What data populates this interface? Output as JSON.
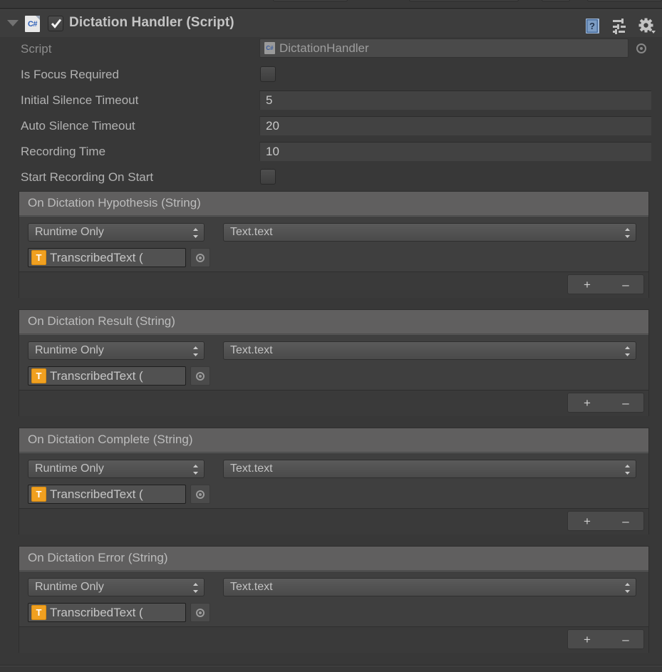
{
  "component": {
    "title": "Dictation Handler (Script)",
    "enabled": true,
    "script_icon": "csharp-script-icon",
    "foldout_expanded": true,
    "header_icons": [
      {
        "name": "help-icon",
        "glyph": "?"
      },
      {
        "name": "preset-icon",
        "glyph": "preset"
      },
      {
        "name": "settings-gear-icon",
        "glyph": "gear"
      }
    ]
  },
  "properties": [
    {
      "label": "Script",
      "type": "object",
      "value": "DictationHandler",
      "dim": true,
      "icon": "csharp-script-icon"
    },
    {
      "label": "Is Focus Required",
      "type": "checkbox",
      "value": false
    },
    {
      "label": "Initial Silence Timeout",
      "type": "number",
      "value": "5"
    },
    {
      "label": "Auto Silence Timeout",
      "type": "number",
      "value": "20"
    },
    {
      "label": "Recording Time",
      "type": "number",
      "value": "10"
    },
    {
      "label": "Start Recording On Start",
      "type": "checkbox",
      "value": false
    }
  ],
  "events": [
    {
      "title": "On Dictation Hypothesis (String)",
      "listener": {
        "mode": "Runtime Only",
        "target": "TranscribedText (",
        "target_icon": "T",
        "method": "Text.text"
      },
      "add_label": "+",
      "remove_label": "–"
    },
    {
      "title": "On Dictation Result (String)",
      "listener": {
        "mode": "Runtime Only",
        "target": "TranscribedText (",
        "target_icon": "T",
        "method": "Text.text"
      },
      "add_label": "+",
      "remove_label": "–"
    },
    {
      "title": "On Dictation Complete (String)",
      "listener": {
        "mode": "Runtime Only",
        "target": "TranscribedText (",
        "target_icon": "T",
        "method": "Text.text"
      },
      "add_label": "+",
      "remove_label": "–"
    },
    {
      "title": "On Dictation Error (String)",
      "listener": {
        "mode": "Runtime Only",
        "target": "TranscribedText (",
        "target_icon": "T",
        "method": "Text.text"
      },
      "add_label": "+",
      "remove_label": "–"
    }
  ],
  "colors": {
    "background": "#383838",
    "header": "#3d3d3d",
    "event_header": "#605f5f",
    "field": "#424242",
    "text": "#b2b2b2",
    "accent_orange": "#f0a020",
    "accent_blue": "#2c5fb8"
  }
}
